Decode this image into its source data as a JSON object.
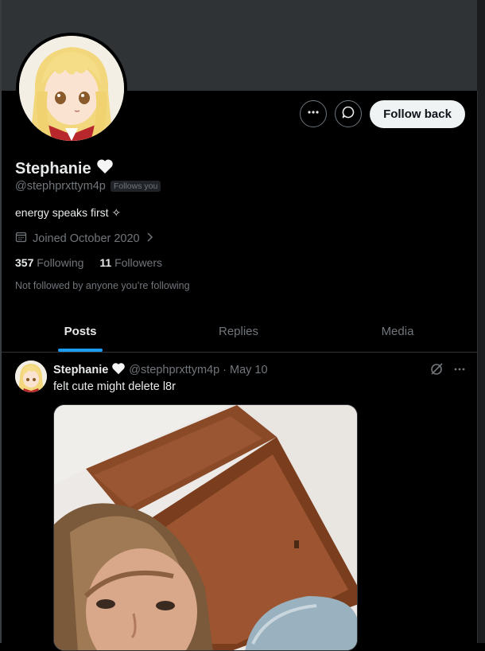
{
  "profile": {
    "name": "Stephanie",
    "handle": "@stephprxttym4p",
    "follows_you_badge": "Follows you",
    "bio": "energy speaks first ✧",
    "joined": "Joined October 2020",
    "following_count": "357",
    "following_label": "Following",
    "followers_count": "11",
    "followers_label": "Followers",
    "not_followed_text": "Not followed by anyone you’re following"
  },
  "actions": {
    "more_icon": "more-horizontal-icon",
    "message_icon": "message-icon",
    "follow_back_label": "Follow back"
  },
  "tabs": [
    {
      "label": "Posts",
      "active": true
    },
    {
      "label": "Replies",
      "active": false
    },
    {
      "label": "Media",
      "active": false
    }
  ],
  "post": {
    "author": "Stephanie",
    "handle": "@stephprxttym4p",
    "separator": "·",
    "date": "May 10",
    "text": "felt cute might delete l8r"
  },
  "colors": {
    "banner": "#2f3336",
    "accent": "#1d9bf0",
    "muted_text": "#71767b"
  }
}
